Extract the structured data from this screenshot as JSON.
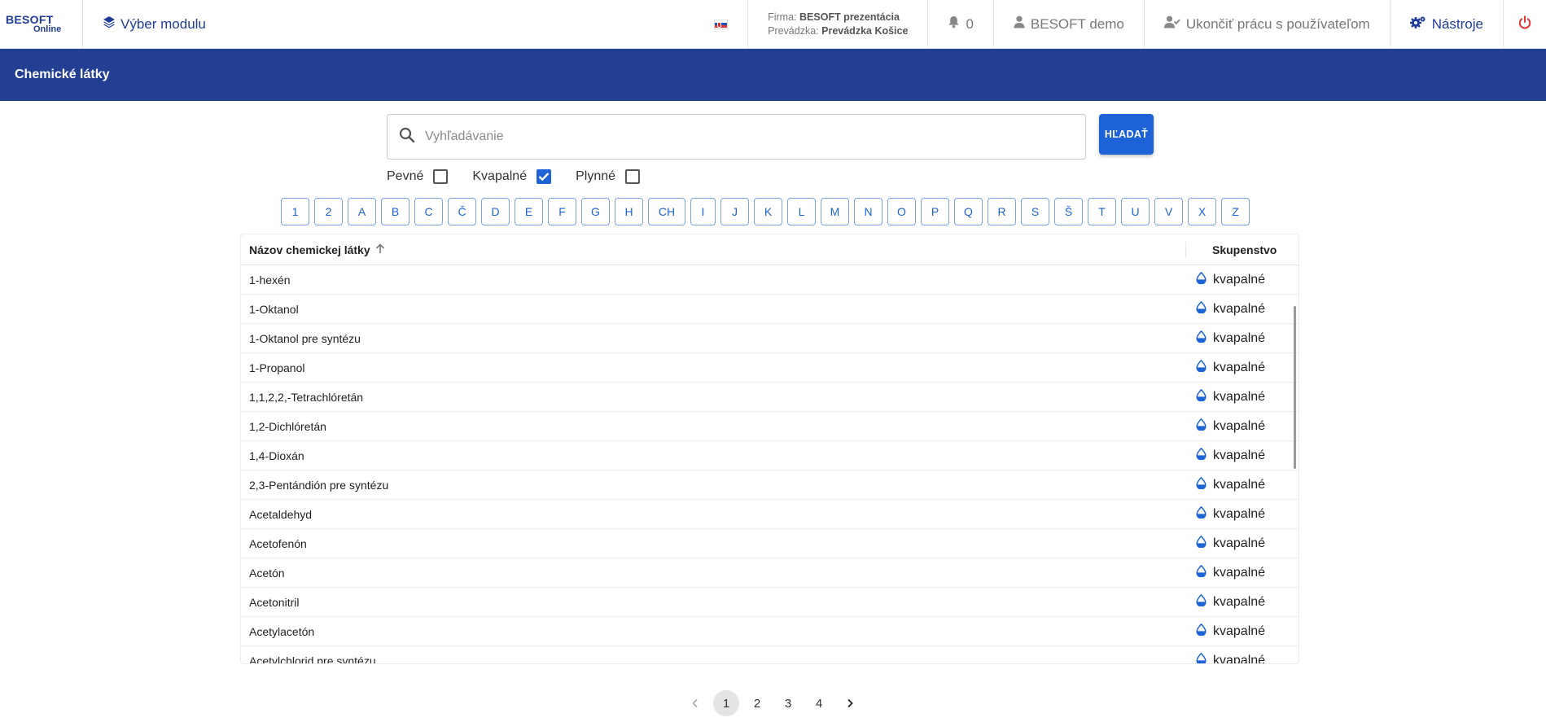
{
  "topbar": {
    "logo_top": "BESOFT",
    "logo_bottom": "Online",
    "module_label": "Výber modulu",
    "firm_label": "Firma:",
    "firm_value": "BESOFT prezentácia",
    "shop_label": "Prevádzka:",
    "shop_value": "Prevádzka Košice",
    "notifications": "0",
    "user": "BESOFT demo",
    "end_work": "Ukončiť prácu s používateľom",
    "tools": "Nástroje"
  },
  "page": {
    "title": "Chemické látky"
  },
  "search": {
    "placeholder": "Vyhľadávanie",
    "button": "HĽADAŤ"
  },
  "filters": [
    {
      "label": "Pevné",
      "checked": false
    },
    {
      "label": "Kvapalné",
      "checked": true
    },
    {
      "label": "Plynné",
      "checked": false
    }
  ],
  "alphabet": [
    "1",
    "2",
    "A",
    "B",
    "C",
    "Č",
    "D",
    "E",
    "F",
    "G",
    "H",
    "CH",
    "I",
    "J",
    "K",
    "L",
    "M",
    "N",
    "O",
    "P",
    "Q",
    "R",
    "S",
    "Š",
    "T",
    "U",
    "V",
    "X",
    "Z"
  ],
  "table": {
    "col_name": "Názov chemickej látky",
    "col_state": "Skupenstvo",
    "rows": [
      {
        "name": "1-hexén",
        "state": "kvapalné"
      },
      {
        "name": "1-Oktanol",
        "state": "kvapalné"
      },
      {
        "name": "1-Oktanol pre syntézu",
        "state": "kvapalné"
      },
      {
        "name": "1-Propanol",
        "state": "kvapalné"
      },
      {
        "name": "1,1,2,2,-Tetrachlóretán",
        "state": "kvapalné"
      },
      {
        "name": "1,2-Dichlóretán",
        "state": "kvapalné"
      },
      {
        "name": "1,4-Dioxán",
        "state": "kvapalné"
      },
      {
        "name": "2,3-Pentándión pre syntézu",
        "state": "kvapalné"
      },
      {
        "name": "Acetaldehyd",
        "state": "kvapalné"
      },
      {
        "name": "Acetofenón",
        "state": "kvapalné"
      },
      {
        "name": "Acetón",
        "state": "kvapalné"
      },
      {
        "name": "Acetonitril",
        "state": "kvapalné"
      },
      {
        "name": "Acetylacetón",
        "state": "kvapalné"
      },
      {
        "name": "Acetylchlorid pre syntézu",
        "state": "kvapalné"
      }
    ]
  },
  "pagination": {
    "pages": [
      "1",
      "2",
      "3",
      "4"
    ],
    "current": "1"
  },
  "colors": {
    "brand": "#233f93",
    "accent": "#1d62d6",
    "power": "#e3342f"
  }
}
